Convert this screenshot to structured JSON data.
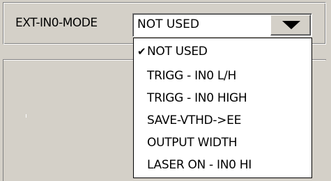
{
  "mode_label": "EXT-IN0-MODE",
  "combo": {
    "selected_value": "NOT USED"
  },
  "dropdown": {
    "checkmark": "✔",
    "items": [
      {
        "label": "NOT USED",
        "checked": true
      },
      {
        "label": "TRIGG - IN0  L/H",
        "checked": false
      },
      {
        "label": "TRIGG - IN0  HIGH",
        "checked": false
      },
      {
        "label": "SAVE-VTHD->EE",
        "checked": false
      },
      {
        "label": "OUTPUT WIDTH",
        "checked": false
      },
      {
        "label": "LASER ON - IN0 HI",
        "checked": false
      }
    ]
  }
}
